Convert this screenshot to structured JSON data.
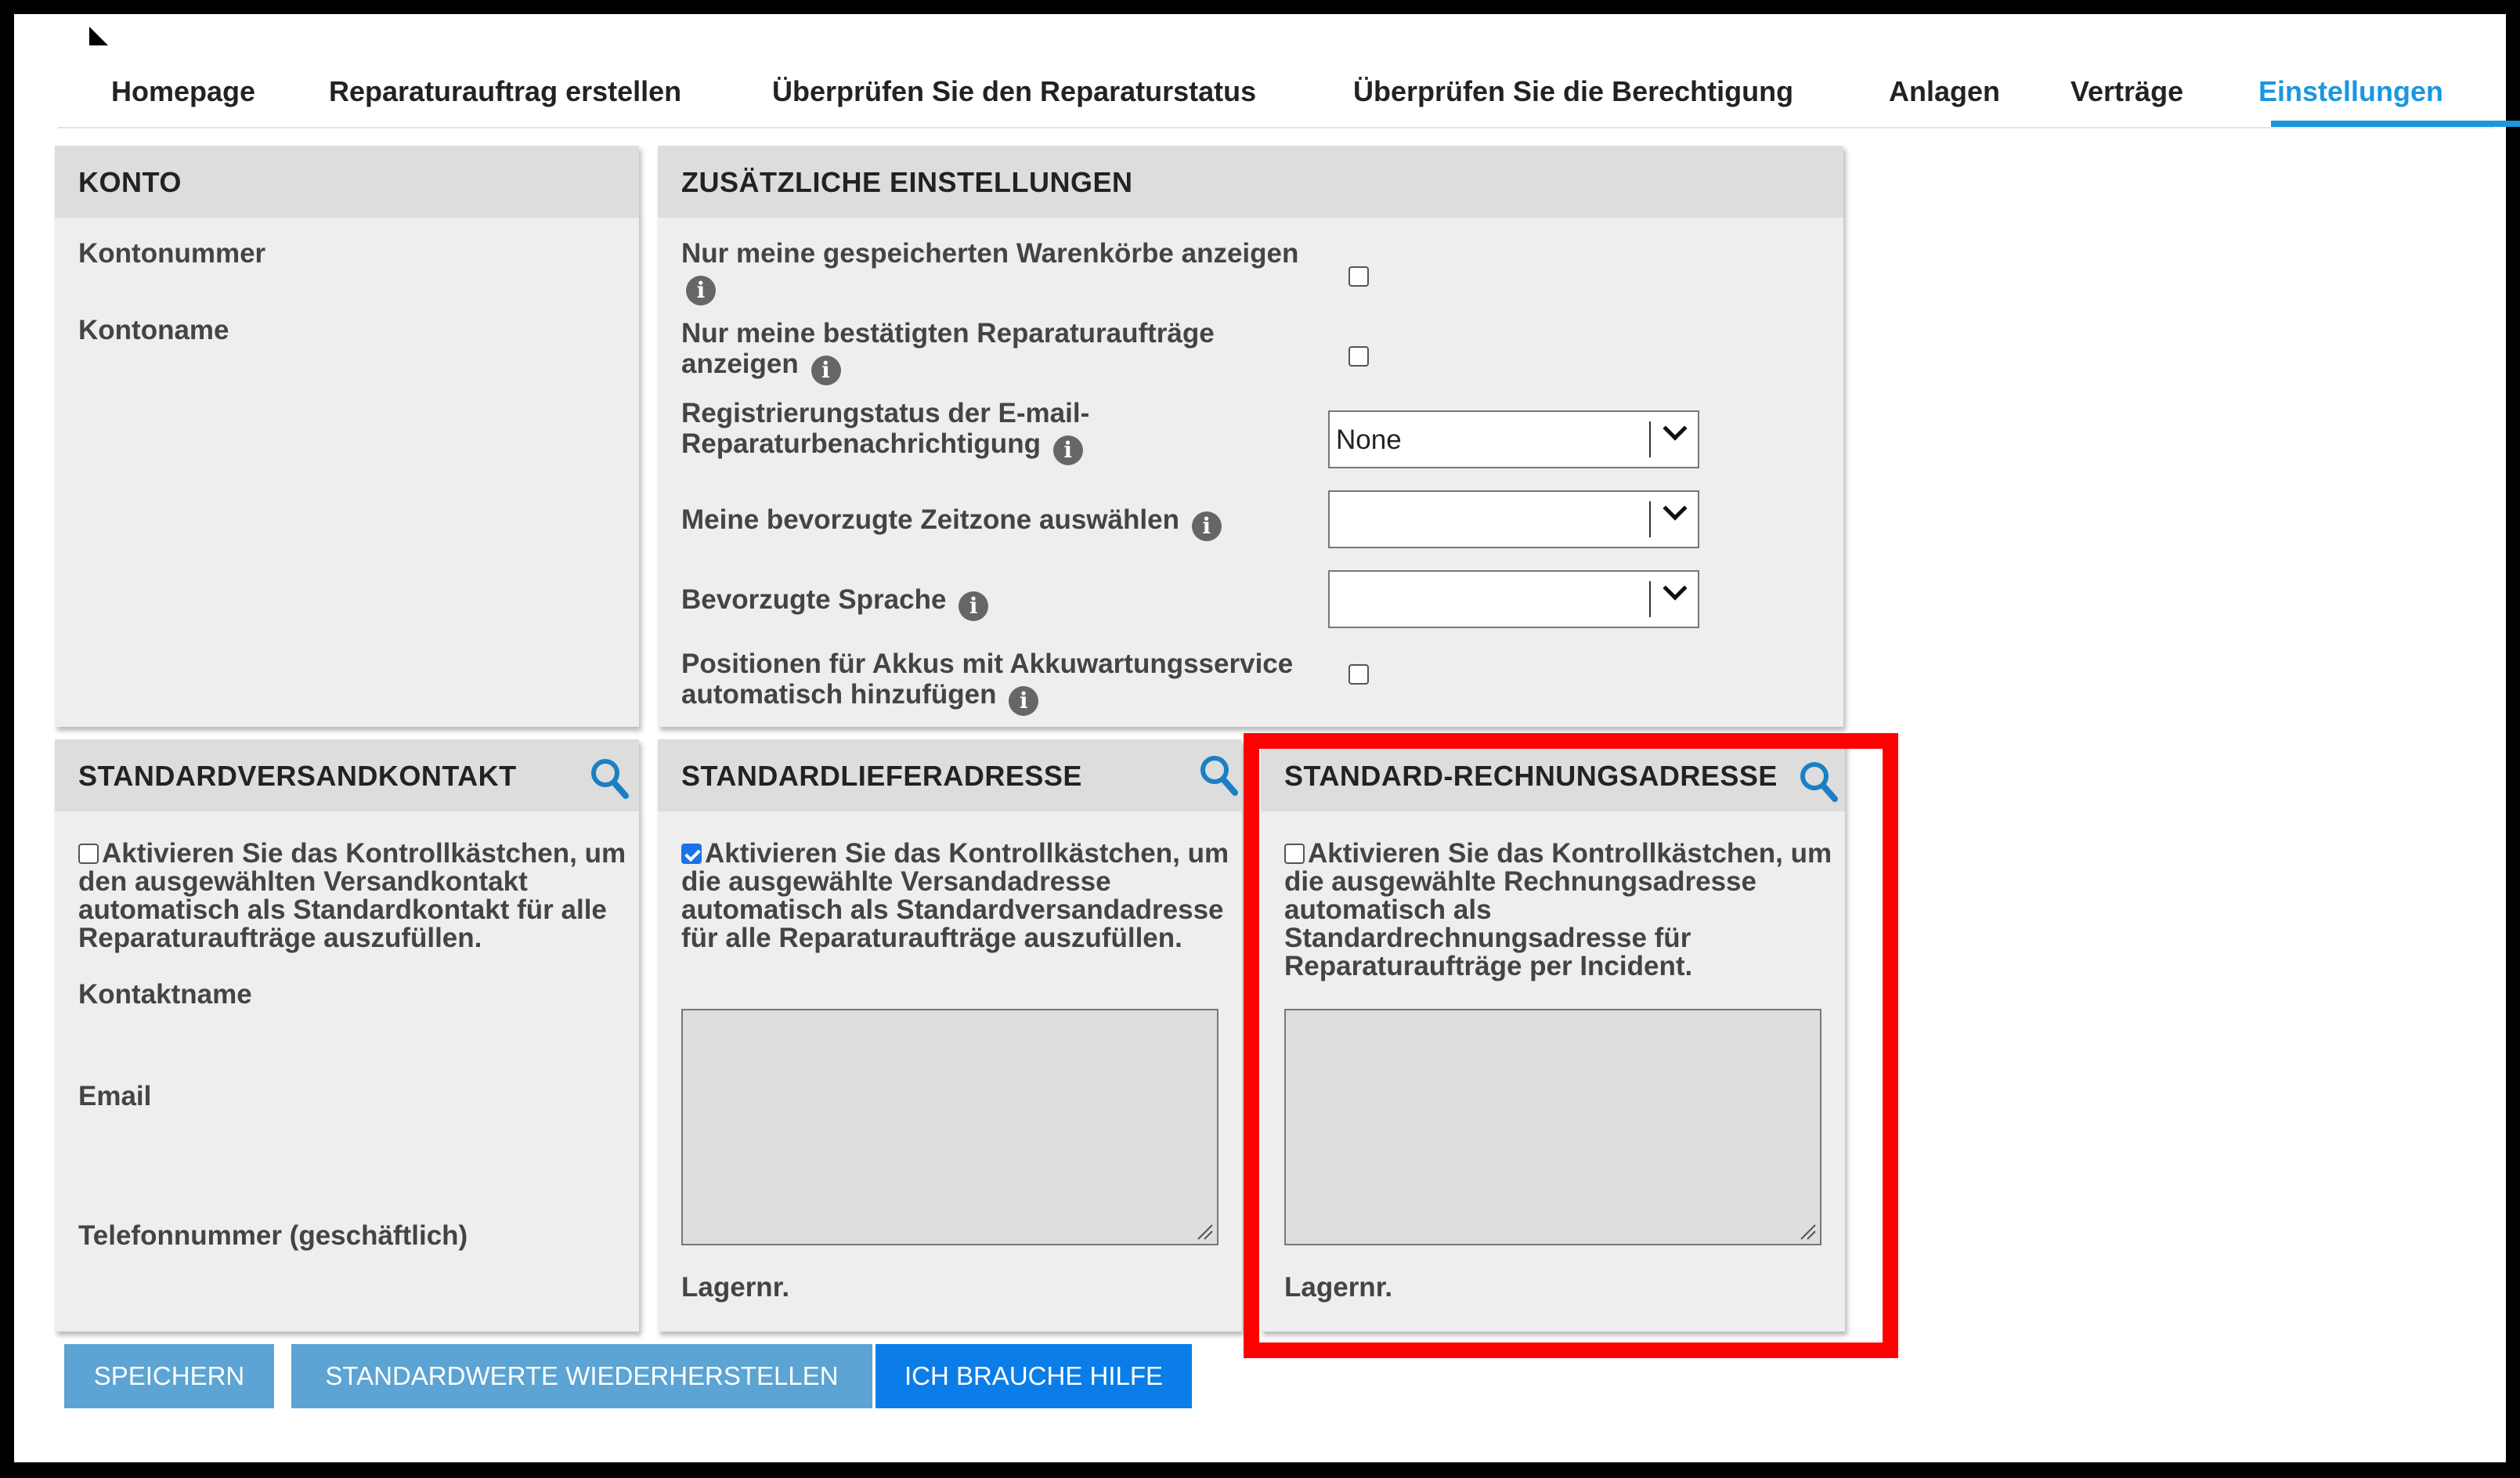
{
  "nav": {
    "items": [
      {
        "label": "Homepage"
      },
      {
        "label": "Reparaturauftrag erstellen"
      },
      {
        "label": "Überprüfen Sie den Reparaturstatus"
      },
      {
        "label": "Überprüfen Sie die Berechtigung"
      },
      {
        "label": "Anlagen"
      },
      {
        "label": "Verträge"
      },
      {
        "label": "Einstellungen"
      }
    ],
    "active": "Einstellungen"
  },
  "konto": {
    "title": "KONTO",
    "account_number_label": "Kontonummer",
    "account_name_label": "Kontoname"
  },
  "settings": {
    "title": "ZUSÄTZLICHE EINSTELLUNGEN",
    "saved_carts_label": "Nur meine gespeicherten Warenkörbe anzeigen",
    "saved_carts_checked": false,
    "confirmed_orders_label": "Nur meine bestätigten Reparaturaufträge anzeigen",
    "confirmed_orders_checked": false,
    "email_status_label": "Registrierungstatus der E-mail-Reparaturbenachrichtigung",
    "email_status_value": "None",
    "timezone_label": "Meine bevorzugte Zeitzone auswählen",
    "timezone_value": "",
    "language_label": "Bevorzugte Sprache",
    "language_value": "",
    "battery_label": "Positionen für Akkus mit Akkuwartungsservice automatisch hinzufügen",
    "battery_checked": false
  },
  "shipping_contact": {
    "title": "STANDARDVERSANDKONTAKT",
    "checkbox_text": "Aktivieren Sie das Kontrollkästchen, um den ausgewählten Versandkontakt automatisch als Standardkontakt für alle Reparaturaufträge auszufüllen.",
    "checked": false,
    "contact_name_label": "Kontaktname",
    "email_label": "Email",
    "phone_label": "Telefonnummer (geschäftlich)"
  },
  "delivery_address": {
    "title": "STANDARDLIEFERADRESSE",
    "checkbox_text": "Aktivieren Sie das Kontrollkästchen, um die ausgewählte Versandadresse automatisch als Standardversandadresse für alle Reparaturaufträge auszufüllen.",
    "checked": true,
    "address_value": "",
    "store_label": "Lagernr."
  },
  "billing_address": {
    "title": "STANDARD-RECHNUNGSADRESSE",
    "checkbox_text": "Aktivieren Sie das Kontrollkästchen, um die ausgewählte Rechnungsadresse automatisch als Standardrechnungsadresse für Reparaturaufträge per Incident.",
    "checked": false,
    "address_value": "",
    "store_label": "Lagernr."
  },
  "buttons": {
    "save": "SPEICHERN",
    "restore": "STANDARDWERTE WIEDERHERSTELLEN",
    "help": "ICH BRAUCHE HILFE"
  },
  "colors": {
    "accent": "#1a97e0",
    "button_light": "#5ba4d3",
    "button_primary": "#0b7de8",
    "highlight": "#ff0000"
  }
}
